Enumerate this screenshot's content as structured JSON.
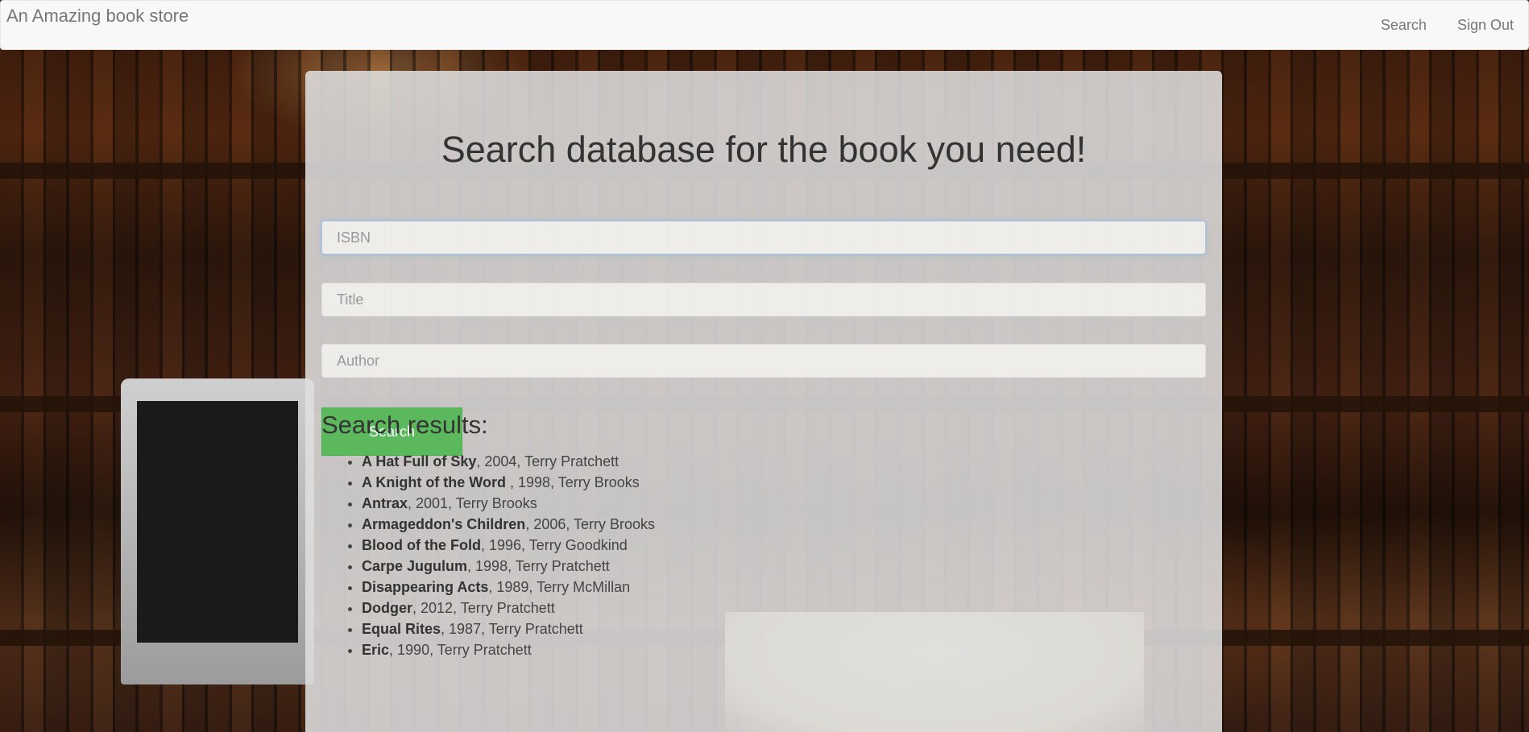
{
  "navbar": {
    "brand": "An Amazing book store",
    "links": [
      "Search",
      "Sign Out"
    ]
  },
  "main": {
    "heading": "Search database for the book you need!",
    "fields": {
      "isbn_placeholder": "ISBN",
      "title_placeholder": "Title",
      "author_placeholder": "Author"
    },
    "search_button": "Search",
    "results_title": "Search results:",
    "results": [
      {
        "title": "A Hat Full of Sky",
        "rest": ", 2004, Terry Pratchett"
      },
      {
        "title": "A Knight of the Word ",
        "rest": ", 1998, Terry Brooks"
      },
      {
        "title": "Antrax",
        "rest": ", 2001, Terry Brooks"
      },
      {
        "title": "Armageddon's Children",
        "rest": ", 2006, Terry Brooks"
      },
      {
        "title": "Blood of the Fold",
        "rest": ", 1996, Terry Goodkind"
      },
      {
        "title": "Carpe Jugulum",
        "rest": ", 1998, Terry Pratchett"
      },
      {
        "title": "Disappearing Acts",
        "rest": ", 1989, Terry McMillan"
      },
      {
        "title": "Dodger",
        "rest": ", 2012, Terry Pratchett"
      },
      {
        "title": "Equal Rites",
        "rest": ", 1987, Terry Pratchett"
      },
      {
        "title": "Eric",
        "rest": ", 1990, Terry Pratchett"
      }
    ]
  }
}
